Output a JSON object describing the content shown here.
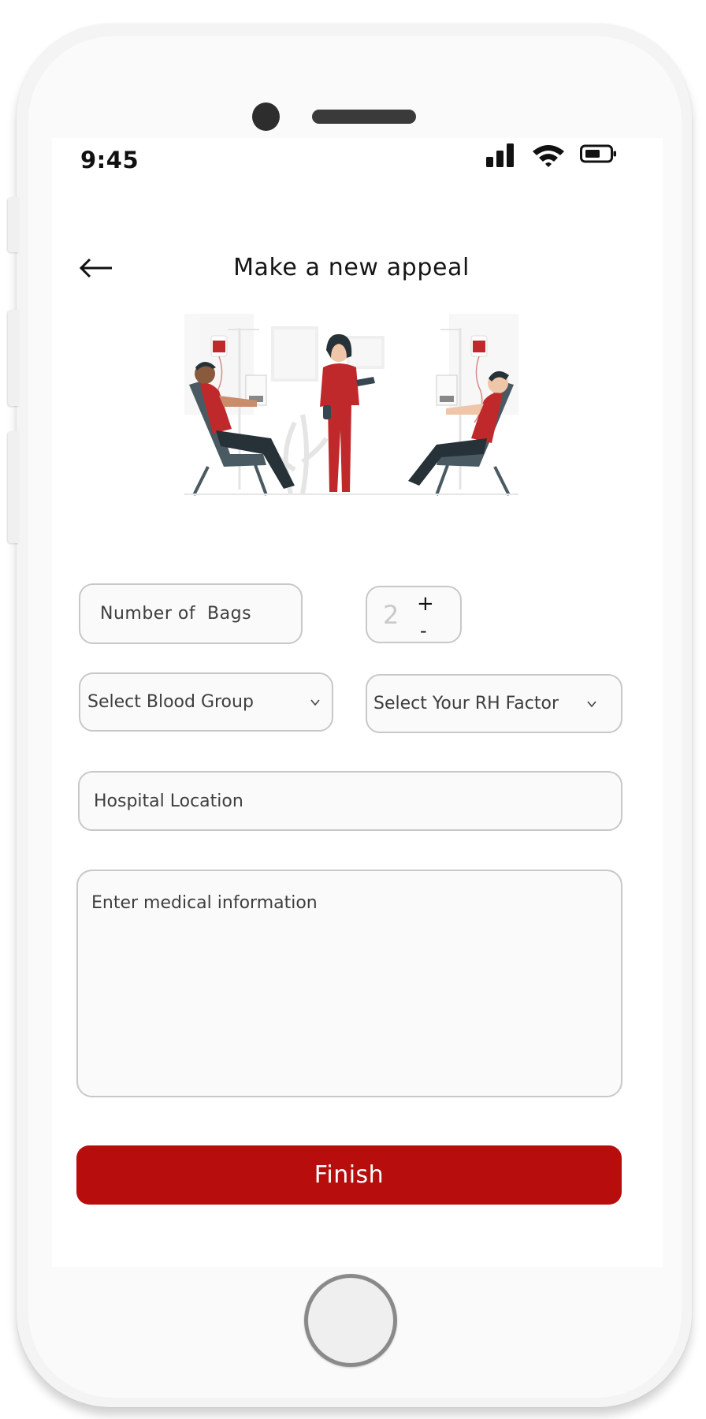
{
  "status_bar": {
    "time": "9:45",
    "icons": [
      "signal-icon",
      "wifi-icon",
      "battery-icon"
    ]
  },
  "header": {
    "back_icon": "arrow-left-icon",
    "title": "Make a new appeal"
  },
  "illustration": {
    "description": "blood donation scene with two donors in chairs and a nurse",
    "colors": {
      "accent": "#c0292b",
      "chair": "#4a5a63"
    }
  },
  "form": {
    "bags_label": "Number of  Bags",
    "bags_stepper": {
      "value": "2",
      "increment_label": "+",
      "decrement_label": "-"
    },
    "blood_group": {
      "placeholder": "Select Blood Group",
      "icon": "chevron-down-icon"
    },
    "rh_factor": {
      "placeholder": "Select Your RH Factor",
      "icon": "chevron-down-icon"
    },
    "hospital_location": {
      "placeholder": "Hospital Location"
    },
    "medical_info": {
      "placeholder": "Enter medical information"
    }
  },
  "actions": {
    "finish_label": "Finish"
  },
  "theme": {
    "primary": "#b70d0d",
    "field_border": "#c8c8c8",
    "field_bg": "#fafafa"
  }
}
